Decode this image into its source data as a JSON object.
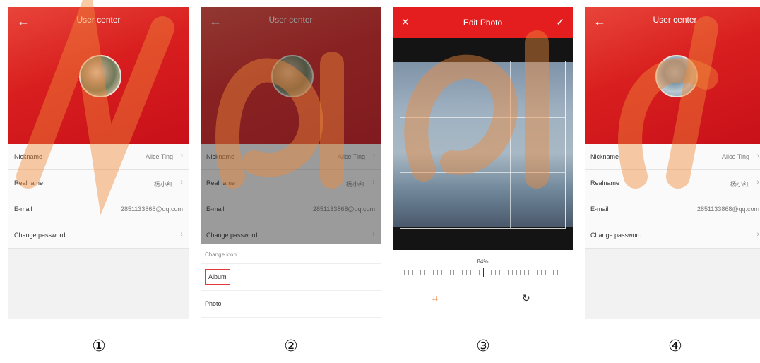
{
  "screens": [
    {
      "title": "User center",
      "rows": [
        {
          "label": "Nickname",
          "value": "Alice Ting"
        },
        {
          "label": "Realname",
          "value": "杨小红"
        },
        {
          "label": "E-mail",
          "value": "2851133868@qq.com"
        },
        {
          "label": "Change password",
          "value": ""
        }
      ]
    },
    {
      "title": "User center",
      "rows": [
        {
          "label": "Nickname",
          "value": "Alice Ting"
        },
        {
          "label": "Realname",
          "value": "杨小红"
        },
        {
          "label": "E-mail",
          "value": "2851133868@qq.com"
        },
        {
          "label": "Change password",
          "value": ""
        }
      ],
      "sheet": {
        "header": "Change icon",
        "items": [
          "Album",
          "Photo"
        ]
      }
    },
    {
      "title": "Edit Photo",
      "zoom_percent": "84%"
    },
    {
      "title": "User center",
      "rows": [
        {
          "label": "Nickname",
          "value": "Alice Ting"
        },
        {
          "label": "Realname",
          "value": "杨小红"
        },
        {
          "label": "E-mail",
          "value": "2851133868@qq.com"
        },
        {
          "label": "Change password",
          "value": ""
        }
      ]
    }
  ],
  "step_numbers": [
    "①",
    "②",
    "③",
    "④"
  ],
  "colors": {
    "brand_red": "#e41e1e",
    "highlight": "#e03a3a",
    "crop_tool": "#e8792a"
  }
}
